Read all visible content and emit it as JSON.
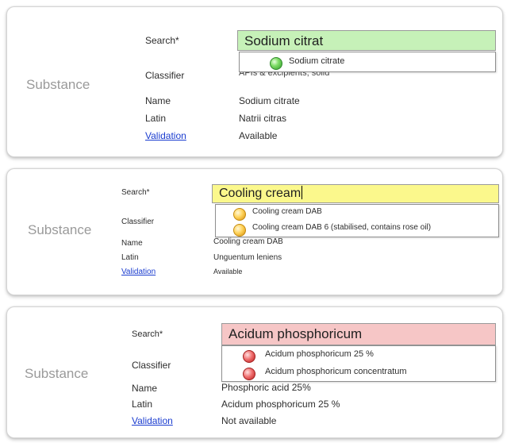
{
  "panels": [
    {
      "title": "Substance",
      "search_label": "Search*",
      "search_value": "Sodium citrat",
      "status_color": "#c6f1b8",
      "suggestions": [
        {
          "icon": "green-status-icon",
          "text": "Sodium citrate"
        }
      ],
      "classifier_label": "Classifier",
      "classifier_value": "APIs & excipients, solid",
      "name_label": "Name",
      "name_value": "Sodium citrate",
      "latin_label": "Latin",
      "latin_value": "Natrii citras",
      "validation_label": "Validation",
      "validation_value": "Available"
    },
    {
      "title": "Substance",
      "search_label": "Search*",
      "search_value": "Cooling cream",
      "status_color": "#fbf88c",
      "suggestions": [
        {
          "icon": "yellow-status-icon",
          "text": "Cooling cream DAB"
        },
        {
          "icon": "yellow-status-icon",
          "text": "Cooling cream DAB 6 (stabilised, contains rose oil)"
        }
      ],
      "classifier_label": "Classifier",
      "name_label": "Name",
      "name_value": "Cooling cream DAB",
      "latin_label": "Latin",
      "latin_value": "Unguentum leniens",
      "validation_label": "Validation",
      "validation_value": "Available"
    },
    {
      "title": "Substance",
      "search_label": "Search*",
      "search_value": "Acidum phosphoricum",
      "status_color": "#f6c6c6",
      "suggestions": [
        {
          "icon": "red-status-icon",
          "text": "Acidum phosphoricum 25 %"
        },
        {
          "icon": "red-status-icon",
          "text": "Acidum phosphoricum concentratum"
        }
      ],
      "classifier_label": "Classifier",
      "name_label": "Name",
      "name_value": "Phosphoric acid 25%",
      "latin_label": "Latin",
      "latin_value": "Acidum phosphoricum 25 %",
      "validation_label": "Validation",
      "validation_value": "Not available"
    }
  ]
}
